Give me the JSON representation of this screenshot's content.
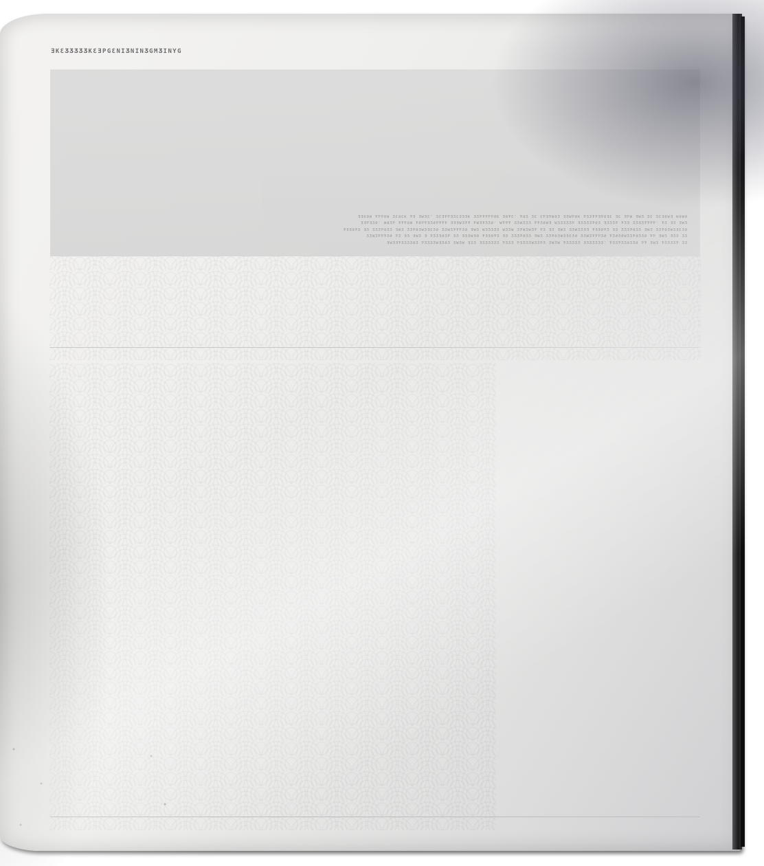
{
  "page": {
    "running_head": "ƎKƐƷƷƷƷƷKƐƎPGƐNIƷNINƷGMƷINYG",
    "hero_caption_lines": [
      "ƎƎKƏW ƤƤƤƏW ƷƐƏƐK ƤƎ ƎWƷƐ' ƷƐƎƤƤƎƷƐƎƎƎK ƎƷƤƤƤƤƤƏK ƎƏƤƐ' ƤƏƷ ƷƐ ƐƤƎƤWƏƷ ƎƷWƤƏK ƤƷƷƤƤƎƤƏƎƐ ƎƐ ƎƤW    ƎWƷ ƷƐ ƷƐƎƏWƎ WƏWƏ",
      "ƎƎƤƎƷƏ' WƏƷƤ ƤƤƤƏW ƤƏƤƤƎƷƏƤƤƤƤ ƎƎƎWƷƤƤ ƤWƎƤƷƷƏ' WƤƤƤ ƷƷWƷƷƷ ƤƤƷƏWƎ WƷƷƷƷƷƤ ƎƷƷƷƷƤƏƷ ƎƷƷƷƤ ƤƷƎ ƷƷƎƷƤƤƤƤ' ƤƷ ƎƷ ƎWƷ",
      "ƤƎƎƏƤƷ ƎƷ ƷƷƷƤƏƷƷ ƎWƷ ƷƷƤƏƷWƷƎƐƷƏ ƷƷWƷƤƤƤƷƏ ƎWƷ WƷƷƷƷƷ WƷƷW ƷƤWƷWƷƤ ƤƷ ƎƷ ƎWƷ ƷƷWƷƷƎƎ ƤƎƎƏƤƷ ƎƷ ƷƷƷƤƏƷƷ ƎWƷ ƷƷƤƏƷWƷƎƐƷƏ",
      "ƷƷWƷƤƤƤƷƏ ƤƷ ƎƷ ƎWƷ Ǝ ƤƷƷƎƏƷƤ ƷƷ ƎƷƷWƎƏ ƤƎƎƏƤƷ ƎƷ ƷƷƷƤƏƷƷ ƎWƷ ƷƷƤƏƷWƷƎƐƷƏ ƷƷWƷƤƤƤƷƏ ƤƷƏƷƏWƷƷƤƏƷƷƏ ƤƤ ƎWƷ ƎƷƷ ƷƷ",
      "ƎWƷƎƤƷƷƷƷƏƷ ƤƷƷƷƷWƎƷƏƷ ƷWƷW ƎƷƷ ƎƷƷƷƷƷƷ ƤƷƷƷ ƤƷƷƷƷWƷƷƤƷ ƷWƷW ƤƷƷƷƷƷ ƎƷƷƷƷƷƷ' ƤƷƷƤƷƷƏƷƷƏ ƤƤ ƎWƷ ƤƷƷƷƷƤ ƷƷ"
    ]
  }
}
